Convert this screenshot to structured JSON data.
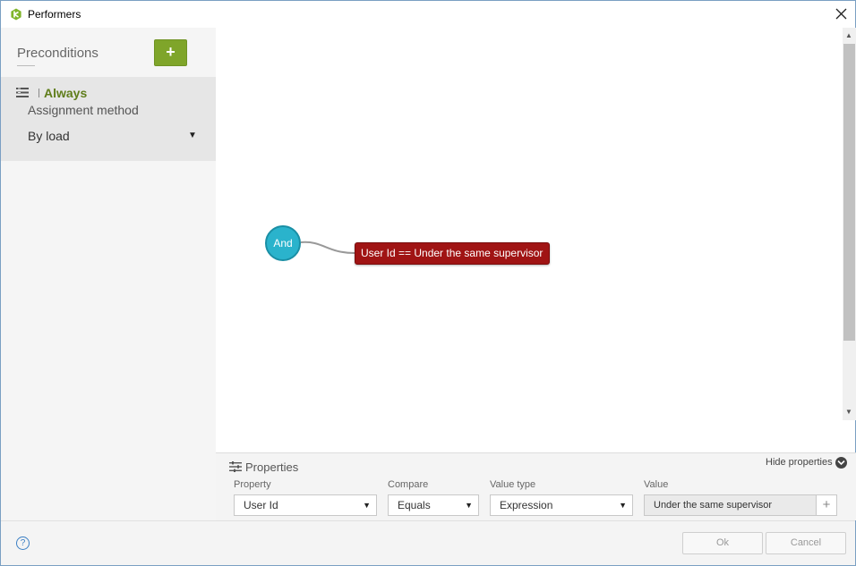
{
  "window": {
    "title": "Performers"
  },
  "colors": {
    "accent_green": "#7fa52a",
    "and_node": "#2ab3cc",
    "condition_node": "#a01414"
  },
  "sidebar": {
    "title": "Preconditions",
    "add_label": "+",
    "item": {
      "name": "Always",
      "assignment_label": "Assignment method",
      "assignment_value": "By load"
    }
  },
  "diagram": {
    "and_node": "And",
    "condition": "User Id == Under the same supervisor"
  },
  "properties": {
    "title": "Properties",
    "hide_label": "Hide properties",
    "property": {
      "label": "Property",
      "value": "User Id"
    },
    "compare": {
      "label": "Compare",
      "value": "Equals"
    },
    "value_type": {
      "label": "Value type",
      "value": "Expression"
    },
    "value": {
      "label": "Value",
      "value": "Under the same supervisor",
      "add_label": "+"
    }
  },
  "footer": {
    "help_label": "?",
    "ok_label": "Ok",
    "cancel_label": "Cancel"
  }
}
